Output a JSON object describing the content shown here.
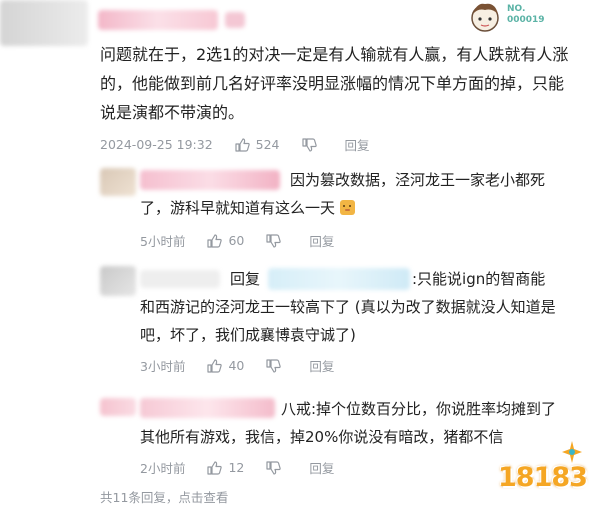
{
  "badge": {
    "id": "NO.\n000019"
  },
  "main_comment": {
    "text": "问题就在于，2选1的对决一定是有人输就有人赢，有人跌就有人涨的，他能做到前几名好评率没明显涨幅的情况下单方面的掉，只能说是演都不带演的。",
    "timestamp": "2024-09-25 19:32",
    "likes": "524",
    "reply_label": "回复"
  },
  "replies": [
    {
      "text": "因为篡改数据，泾河龙王一家老小都死了，游科早就知道有这么一天",
      "emoji": "doge-emoji",
      "time": "5小时前",
      "likes": "60",
      "reply_label": "回复"
    },
    {
      "reply_prefix": "回复",
      "text_line1": ":只能说ign的智商能",
      "text_rest": "和西游记的泾河龙王一较高下了 (真以为改了数据就没人知道是吧，坏了，我们成襄博袁守诚了)",
      "time": "3小时前",
      "likes": "40",
      "reply_label": "回复"
    },
    {
      "text": "八戒:掉个位数百分比，你说胜率均摊到了其他所有游戏，我信，掉20%你说没有暗改，猪都不信",
      "time": "2小时前",
      "likes": "12",
      "reply_label": "回复"
    }
  ],
  "footer": {
    "text": "共11条回复，点击查看"
  },
  "watermark": {
    "text": "18183"
  },
  "colors": {
    "meta": "#9499a0",
    "watermark_orange": "#f5a623",
    "watermark_teal": "#3bb7c9"
  }
}
